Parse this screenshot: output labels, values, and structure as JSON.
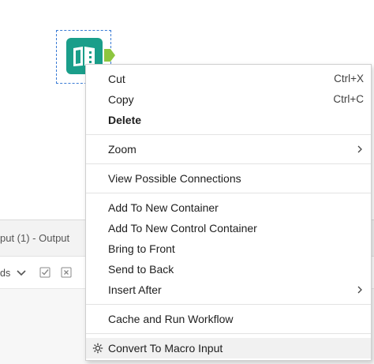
{
  "results_panel": {
    "title": "put (1) - Output",
    "toolbar_text": "ds"
  },
  "context_menu": {
    "cut": {
      "label": "Cut",
      "shortcut": "Ctrl+X"
    },
    "copy": {
      "label": "Copy",
      "shortcut": "Ctrl+C"
    },
    "delete": {
      "label": "Delete"
    },
    "zoom": {
      "label": "Zoom"
    },
    "view_connections": {
      "label": "View Possible Connections"
    },
    "add_container": {
      "label": "Add To New Container"
    },
    "add_control_container": {
      "label": "Add To New Control Container"
    },
    "bring_front": {
      "label": "Bring to Front"
    },
    "send_back": {
      "label": "Send to Back"
    },
    "insert_after": {
      "label": "Insert After"
    },
    "cache_run": {
      "label": "Cache and Run Workflow"
    },
    "convert_macro": {
      "label": "Convert To Macro Input"
    }
  },
  "colors": {
    "tool_teal": "#1a9e8a",
    "anchor_green": "#8dc63f",
    "selection_blue": "#3a7bd5"
  },
  "icons": {
    "tool": "book-input-icon",
    "anchor": "output-anchor",
    "submenu": "chevron-right-icon",
    "macro": "gear-icon"
  }
}
